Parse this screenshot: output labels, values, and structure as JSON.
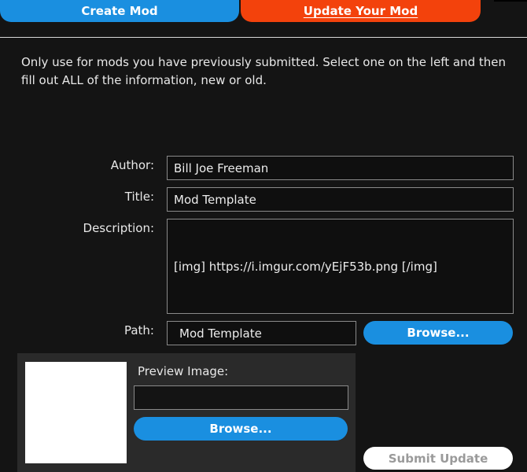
{
  "tabs": {
    "create": "Create Mod",
    "update": "Update Your Mod"
  },
  "instructions": "Only use for mods you have previously submitted. Select one on the left and then fill out ALL of the information, new or old.",
  "form": {
    "author_label": "Author:",
    "author_value": "Bill Joe Freeman",
    "title_label": "Title:",
    "title_value": "Mod Template",
    "description_label": "Description:",
    "description_value": "[img] https://i.imgur.com/yEjF53b.png [/img]",
    "path_label": "Path:",
    "path_value": "Mod Template",
    "browse_label": "Browse..."
  },
  "preview": {
    "label": "Preview Image:",
    "value": "",
    "browse_label": "Browse..."
  },
  "submit_label": "Submit Update",
  "colors": {
    "accent_blue": "#1a8fe0",
    "accent_orange": "#f3420c",
    "background": "#141414"
  }
}
